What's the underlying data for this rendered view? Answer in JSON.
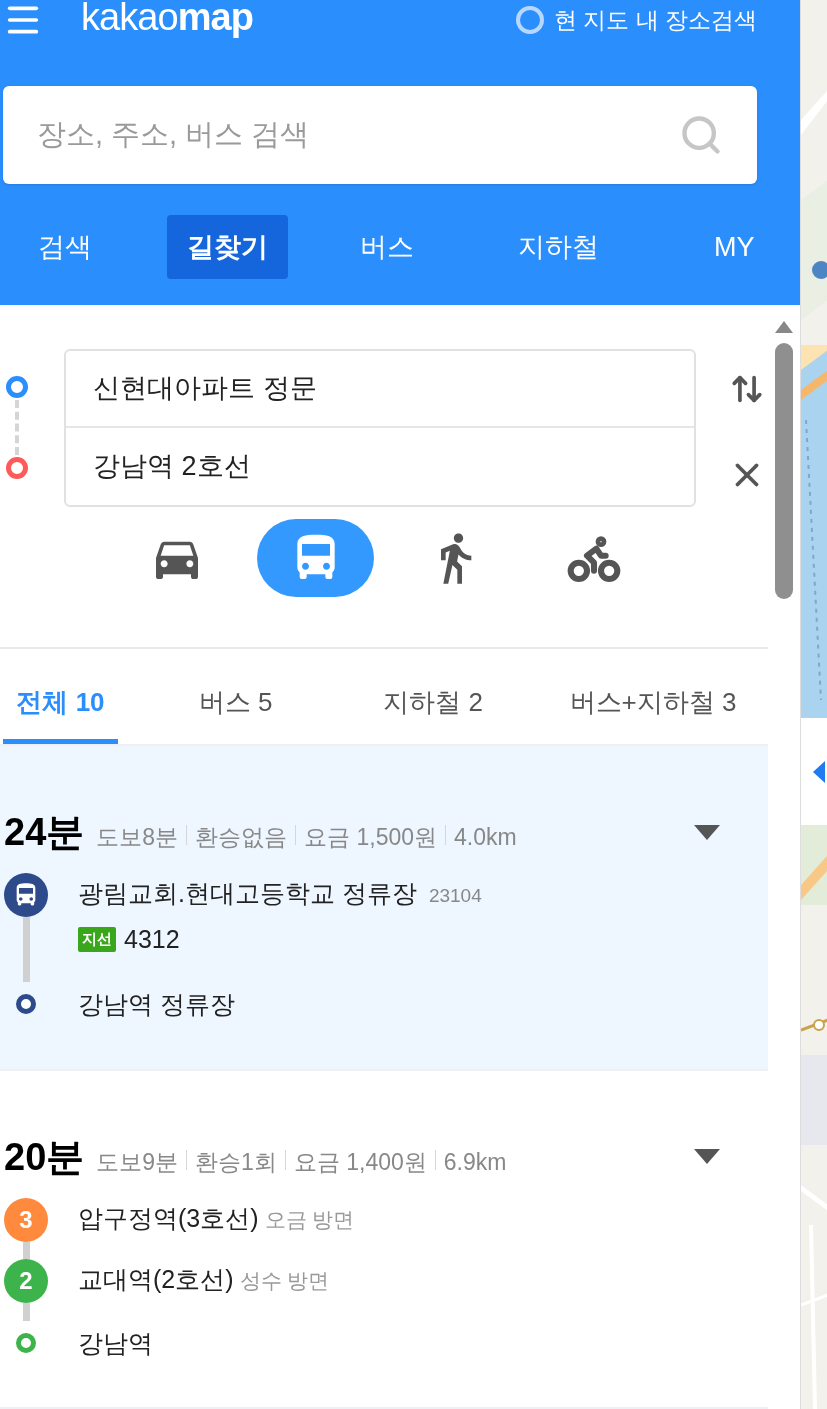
{
  "header": {
    "logo": "kakao**map**",
    "map_search": {
      "label": "현 지도 내 장소검색",
      "checked": false
    },
    "search": {
      "placeholder": "장소, 주소, 버스 검색"
    },
    "tabs": [
      {
        "label": "검색",
        "selected": false
      },
      {
        "label": "길찾기",
        "selected": true
      },
      {
        "label": "버스",
        "selected": false
      },
      {
        "label": "지하철",
        "selected": false
      },
      {
        "label": "MY",
        "selected": false
      }
    ]
  },
  "route": {
    "origin": "신현대아파트 정문",
    "destination": "강남역 2호선",
    "modes": [
      {
        "kind": "car",
        "selected": false
      },
      {
        "kind": "bus",
        "selected": true
      },
      {
        "kind": "walk",
        "selected": false
      },
      {
        "kind": "bike",
        "selected": false
      }
    ]
  },
  "filters": [
    {
      "label": "전체 10",
      "selected": true
    },
    {
      "label": "버스 5",
      "selected": false
    },
    {
      "label": "지하철 2",
      "selected": false
    },
    {
      "label": "버스+지하철 3",
      "selected": false
    }
  ],
  "results": [
    {
      "time": "24분",
      "selected": true,
      "meta": [
        "도보8분",
        "환승없음",
        "요금 1,500원",
        "4.0km"
      ],
      "steps": [
        {
          "kind": "bus",
          "color": "#2d4a8a",
          "name": "광림교회.현대고등학교 정류장",
          "code": "23104",
          "tag": {
            "label": "지선",
            "color": "#3aa61c"
          },
          "number": "4312"
        },
        {
          "kind": "end",
          "color": "#2d4a8a",
          "name": "강남역 정류장"
        }
      ]
    },
    {
      "time": "20분",
      "selected": false,
      "meta": [
        "도보9분",
        "환승1회",
        "요금 1,400원",
        "6.9km"
      ],
      "steps": [
        {
          "kind": "subway",
          "color": "#ff8a3d",
          "line": "3",
          "name": "압구정역(3호선)",
          "direction": "오금 방면"
        },
        {
          "kind": "subway",
          "color": "#3cb44b",
          "line": "2",
          "name": "교대역(2호선)",
          "direction": "성수 방면"
        },
        {
          "kind": "end",
          "color": "#3cb44b",
          "name": "강남역"
        }
      ]
    }
  ]
}
